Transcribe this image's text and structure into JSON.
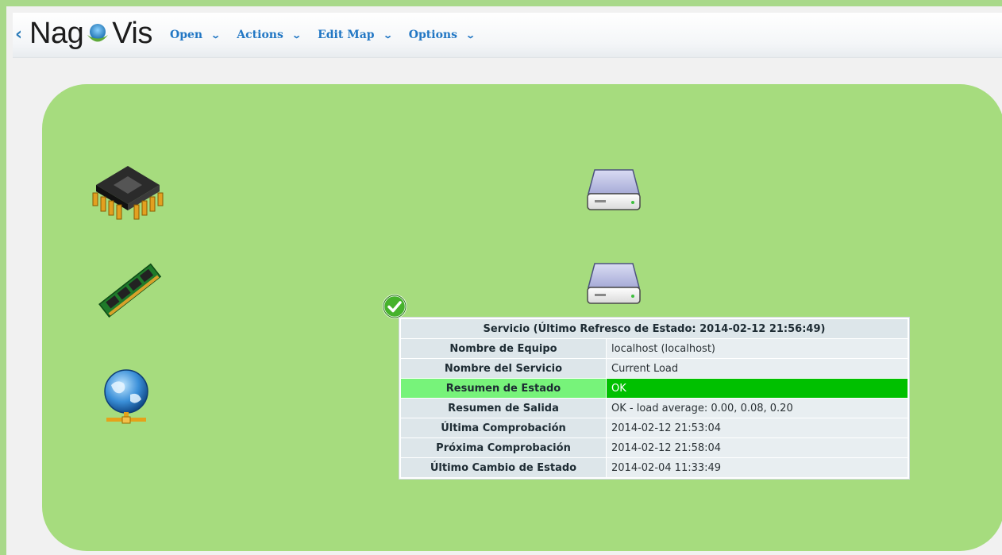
{
  "header": {
    "back": "‹",
    "logo_left": "Nag",
    "logo_right": "Vis",
    "menu": [
      {
        "label": "Open"
      },
      {
        "label": "Actions"
      },
      {
        "label": "Edit Map"
      },
      {
        "label": "Options"
      }
    ]
  },
  "map": {
    "background_color": "#a6dc7e",
    "icons": [
      {
        "name": "cpu-icon"
      },
      {
        "name": "memory-icon"
      },
      {
        "name": "network-icon"
      },
      {
        "name": "disk-icon"
      },
      {
        "name": "disk-icon"
      },
      {
        "name": "ok-status-icon"
      }
    ]
  },
  "hover": {
    "title": "Servicio (Último Refresco de Estado: 2014-02-12 21:56:49)",
    "rows": [
      {
        "label": "Nombre de Equipo",
        "value": "localhost (localhost)"
      },
      {
        "label": "Nombre del Servicio",
        "value": "Current Load"
      },
      {
        "label": "Resumen de Estado",
        "value": "OK"
      },
      {
        "label": "Resumen de Salida",
        "value": "OK - load average: 0.00, 0.08, 0.20"
      },
      {
        "label": "Última Comprobación",
        "value": "2014-02-12 21:53:04"
      },
      {
        "label": "Próxima Comprobación",
        "value": "2014-02-12 21:58:04"
      },
      {
        "label": "Último Cambio de Estado",
        "value": "2014-02-04 11:33:49"
      }
    ],
    "colors": {
      "state_ok": "#00c000",
      "state_label": "#77f37a"
    }
  }
}
